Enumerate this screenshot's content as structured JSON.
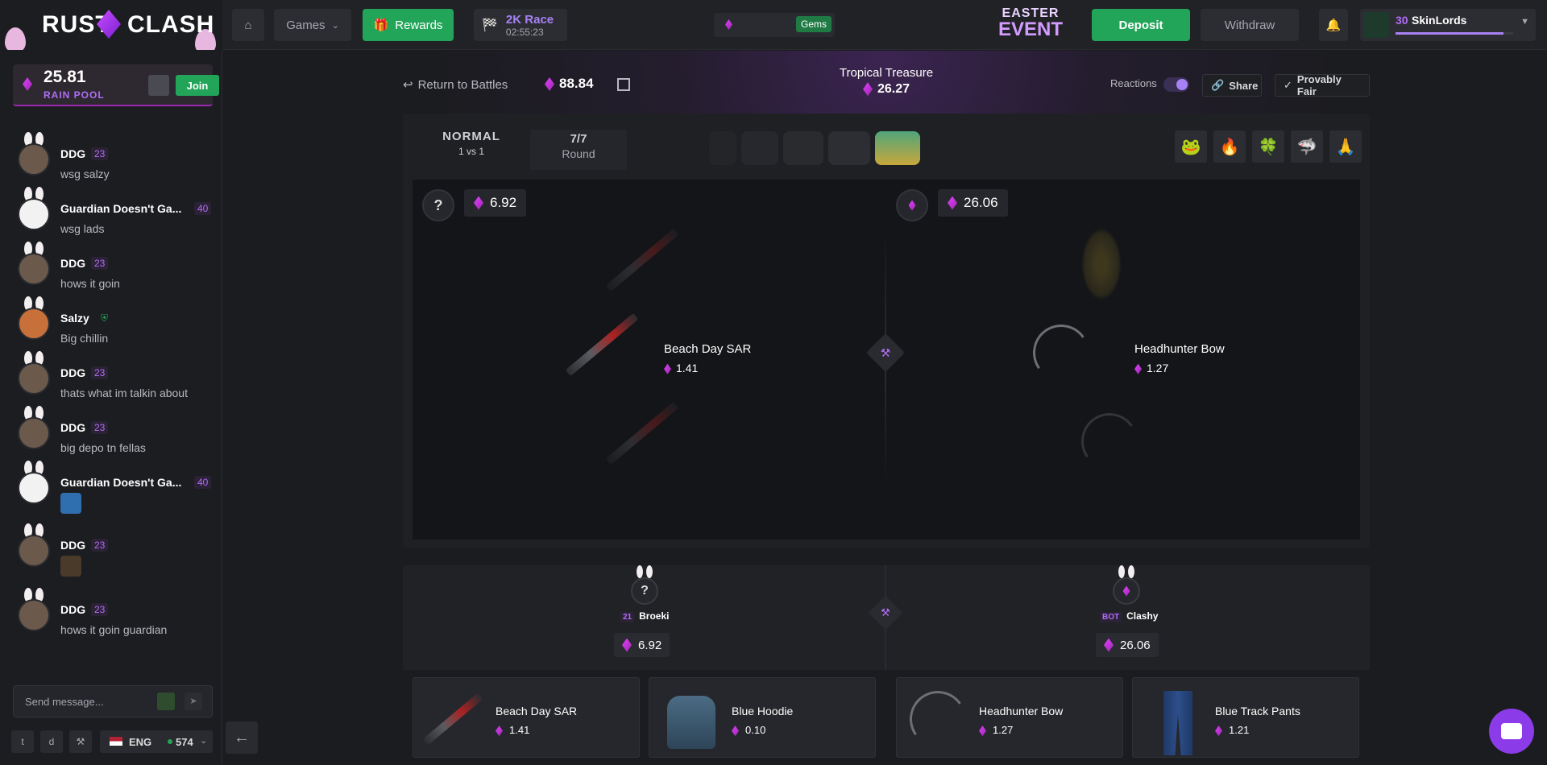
{
  "header": {
    "logo_left": "RUST",
    "logo_right": "CLASH",
    "games_label": "Games",
    "rewards_label": "Rewards",
    "race_title": "2K Race",
    "race_timer": "02:55:23",
    "gems_label": "Gems",
    "easter_line1": "EASTER",
    "easter_line2": "EVENT",
    "deposit_label": "Deposit",
    "withdraw_label": "Withdraw",
    "user_level": "30",
    "username": "SkinLords"
  },
  "rain_pool": {
    "amount": "25.81",
    "label": "RAIN POOL",
    "join_label": "Join"
  },
  "chat": {
    "messages": [
      {
        "user": "DDG",
        "level": "23",
        "text": "wsg salzy"
      },
      {
        "user": "Guardian Doesn't Ga...",
        "level": "40",
        "text": "wsg lads"
      },
      {
        "user": "DDG",
        "level": "23",
        "text": "hows it goin"
      },
      {
        "user": "Salzy",
        "level": "",
        "text": "Big chillin"
      },
      {
        "user": "DDG",
        "level": "23",
        "text": "thats what im talkin about"
      },
      {
        "user": "DDG",
        "level": "23",
        "text": "big depo tn fellas"
      },
      {
        "user": "Guardian Doesn't Ga...",
        "level": "40",
        "text": ""
      },
      {
        "user": "DDG",
        "level": "23",
        "text": ""
      },
      {
        "user": "DDG",
        "level": "23",
        "text": "hows it goin guardian"
      }
    ],
    "input_placeholder": "Send message...",
    "language": "ENG",
    "online_count": "574"
  },
  "battle": {
    "return_label": "Return to Battles",
    "total_value": "88.84",
    "case_name": "Tropical Treasure",
    "case_price": "26.27",
    "reactions_label": "Reactions",
    "share_label": "Share",
    "provably_fair_label": "Provably Fair",
    "mode": "NORMAL",
    "mode_sub": "1 vs 1",
    "round_count": "7/7",
    "round_label": "Round",
    "reactions": [
      "🐸",
      "🔥",
      "🍀",
      "🦈",
      "🙏"
    ]
  },
  "reel": {
    "left": {
      "value": "6.92",
      "help": "?",
      "item_name": "Beach Day SAR",
      "item_value": "1.41"
    },
    "right": {
      "value": "26.06",
      "item_name": "Headhunter Bow",
      "item_value": "1.27"
    }
  },
  "players": [
    {
      "level": "21",
      "name": "Broeki",
      "total": "6.92",
      "avatar": "?"
    },
    {
      "level": "BOT",
      "name": "Clashy",
      "total": "26.06",
      "avatar": ""
    }
  ],
  "won_items": [
    {
      "name": "Beach Day SAR",
      "value": "1.41"
    },
    {
      "name": "Blue Hoodie",
      "value": "0.10"
    },
    {
      "name": "Headhunter Bow",
      "value": "1.27"
    },
    {
      "name": "Blue Track Pants",
      "value": "1.21"
    }
  ],
  "colors": {
    "accent": "#9c27b0",
    "green": "#23a559",
    "purple_text": "#b06ef5"
  }
}
